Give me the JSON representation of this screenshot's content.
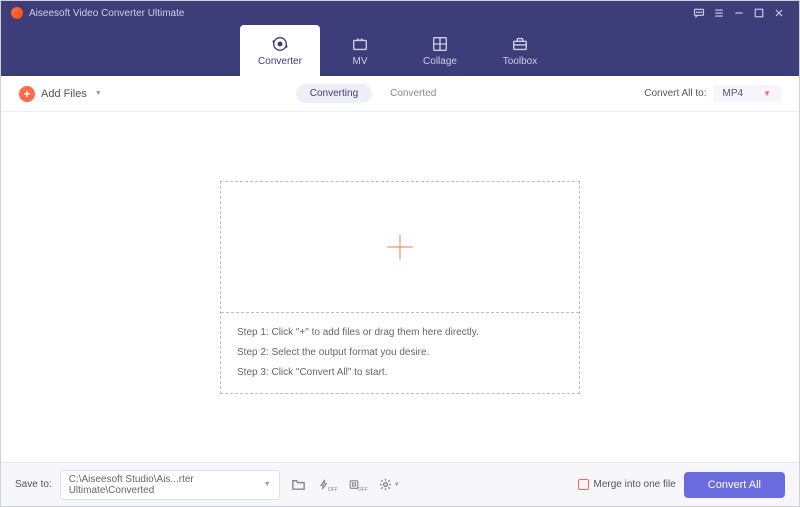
{
  "title": "Aiseesoft Video Converter Ultimate",
  "nav": {
    "tabs": [
      {
        "label": "Converter",
        "active": true
      },
      {
        "label": "MV",
        "active": false
      },
      {
        "label": "Collage",
        "active": false
      },
      {
        "label": "Toolbox",
        "active": false
      }
    ]
  },
  "toolbar": {
    "add_files": "Add Files",
    "seg": [
      {
        "label": "Converting",
        "active": true
      },
      {
        "label": "Converted",
        "active": false
      }
    ],
    "convert_all_to": "Convert All to:",
    "format_selected": "MP4"
  },
  "dropzone": {
    "step1": "Step 1: Click \"+\" to add files or drag them here directly.",
    "step2": "Step 2: Select the output format you desire.",
    "step3": "Step 3: Click \"Convert All\" to start."
  },
  "footer": {
    "save_to": "Save to:",
    "path": "C:\\Aiseesoft Studio\\Ais...rter Ultimate\\Converted",
    "merge": "Merge into one file",
    "convert_all": "Convert All"
  }
}
